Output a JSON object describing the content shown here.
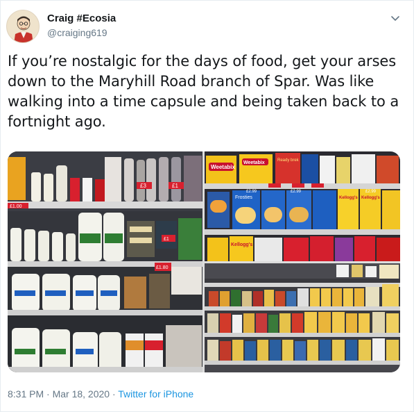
{
  "author": {
    "display_name": "Craig #Ecosia",
    "handle": "@craiging619",
    "avatar_icon": "profile-avatar-illustration"
  },
  "menu": {
    "icon": "chevron-down-icon"
  },
  "tweet": {
    "text": "If you’re nostalgic for the days of food, get your arses down to the Maryhill Road branch of Spar. Was like walking into a time capsule and being taken back to a fortnight ago."
  },
  "media": {
    "photos": [
      {
        "label": "photo-milk-and-dairy-shelves"
      },
      {
        "label": "photo-cereal-shelves",
        "visible_brands": [
          "Weetabix",
          "Weetabix",
          "Ready brek",
          "Frosties",
          "Kellogg's",
          "Kellogg's",
          "Kellogg's"
        ]
      },
      {
        "label": "photo-tinned-food-shelves"
      }
    ],
    "visible_price_tags": [
      "£3",
      "£1",
      "£1",
      "£1.00",
      "£1.80",
      "£1",
      "£2.99",
      "£2.99",
      "£2.99"
    ]
  },
  "meta": {
    "timestamp": "8:31 PM · Mar 18, 2020",
    "separator": " · ",
    "source": "Twitter for iPhone"
  },
  "colors": {
    "text_primary": "#14171a",
    "text_secondary": "#657786",
    "link": "#1b95e0",
    "border": "#e6ecf0"
  }
}
